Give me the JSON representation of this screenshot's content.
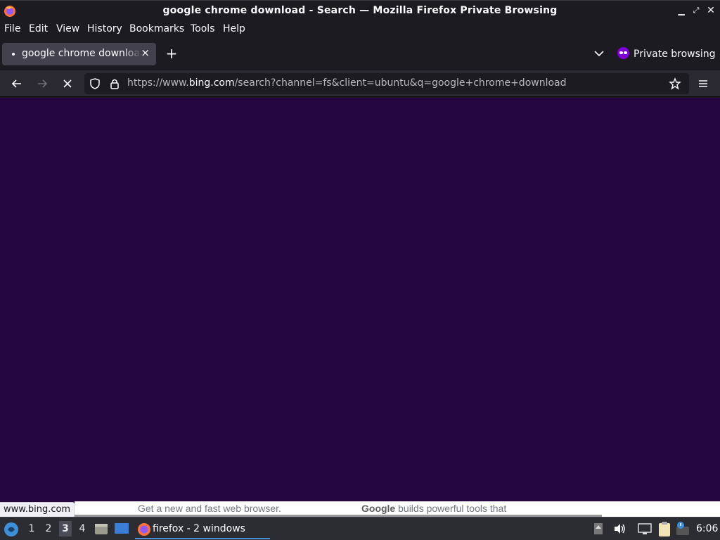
{
  "window": {
    "title": "google chrome download - Search — Mozilla Firefox Private Browsing"
  },
  "menu": {
    "file": "File",
    "edit": "Edit",
    "view": "View",
    "history": "History",
    "bookmarks": "Bookmarks",
    "tools": "Tools",
    "help": "Help"
  },
  "tabs": {
    "active_label": "google chrome download - Search",
    "close_glyph": "×",
    "new_tab_glyph": "+",
    "private_label": "Private browsing"
  },
  "nav": {
    "url_prefix": "https://www.",
    "url_host": "bing.com",
    "url_path": "/search?channel=fs&client=ubuntu&q=google+chrome+download",
    "stop_glyph": "✕"
  },
  "page": {
    "peek_text_1": "Get a new and fast web browser.",
    "peek_text_2_bold": "Google",
    "peek_text_2_rest": " builds powerful tools that",
    "status_url": "www.bing.com"
  },
  "taskbar": {
    "workspaces": [
      "1",
      "2",
      "3",
      "4"
    ],
    "active_workspace": "3",
    "firefox_task": "firefox - 2 windows",
    "clock": "6:06"
  },
  "colors": {
    "chrome_dark": "#1c1b22",
    "navbar": "#2b2a33",
    "content_bg": "#250640",
    "private_accent": "#8000d7",
    "taskbar": "#2b2d33"
  }
}
